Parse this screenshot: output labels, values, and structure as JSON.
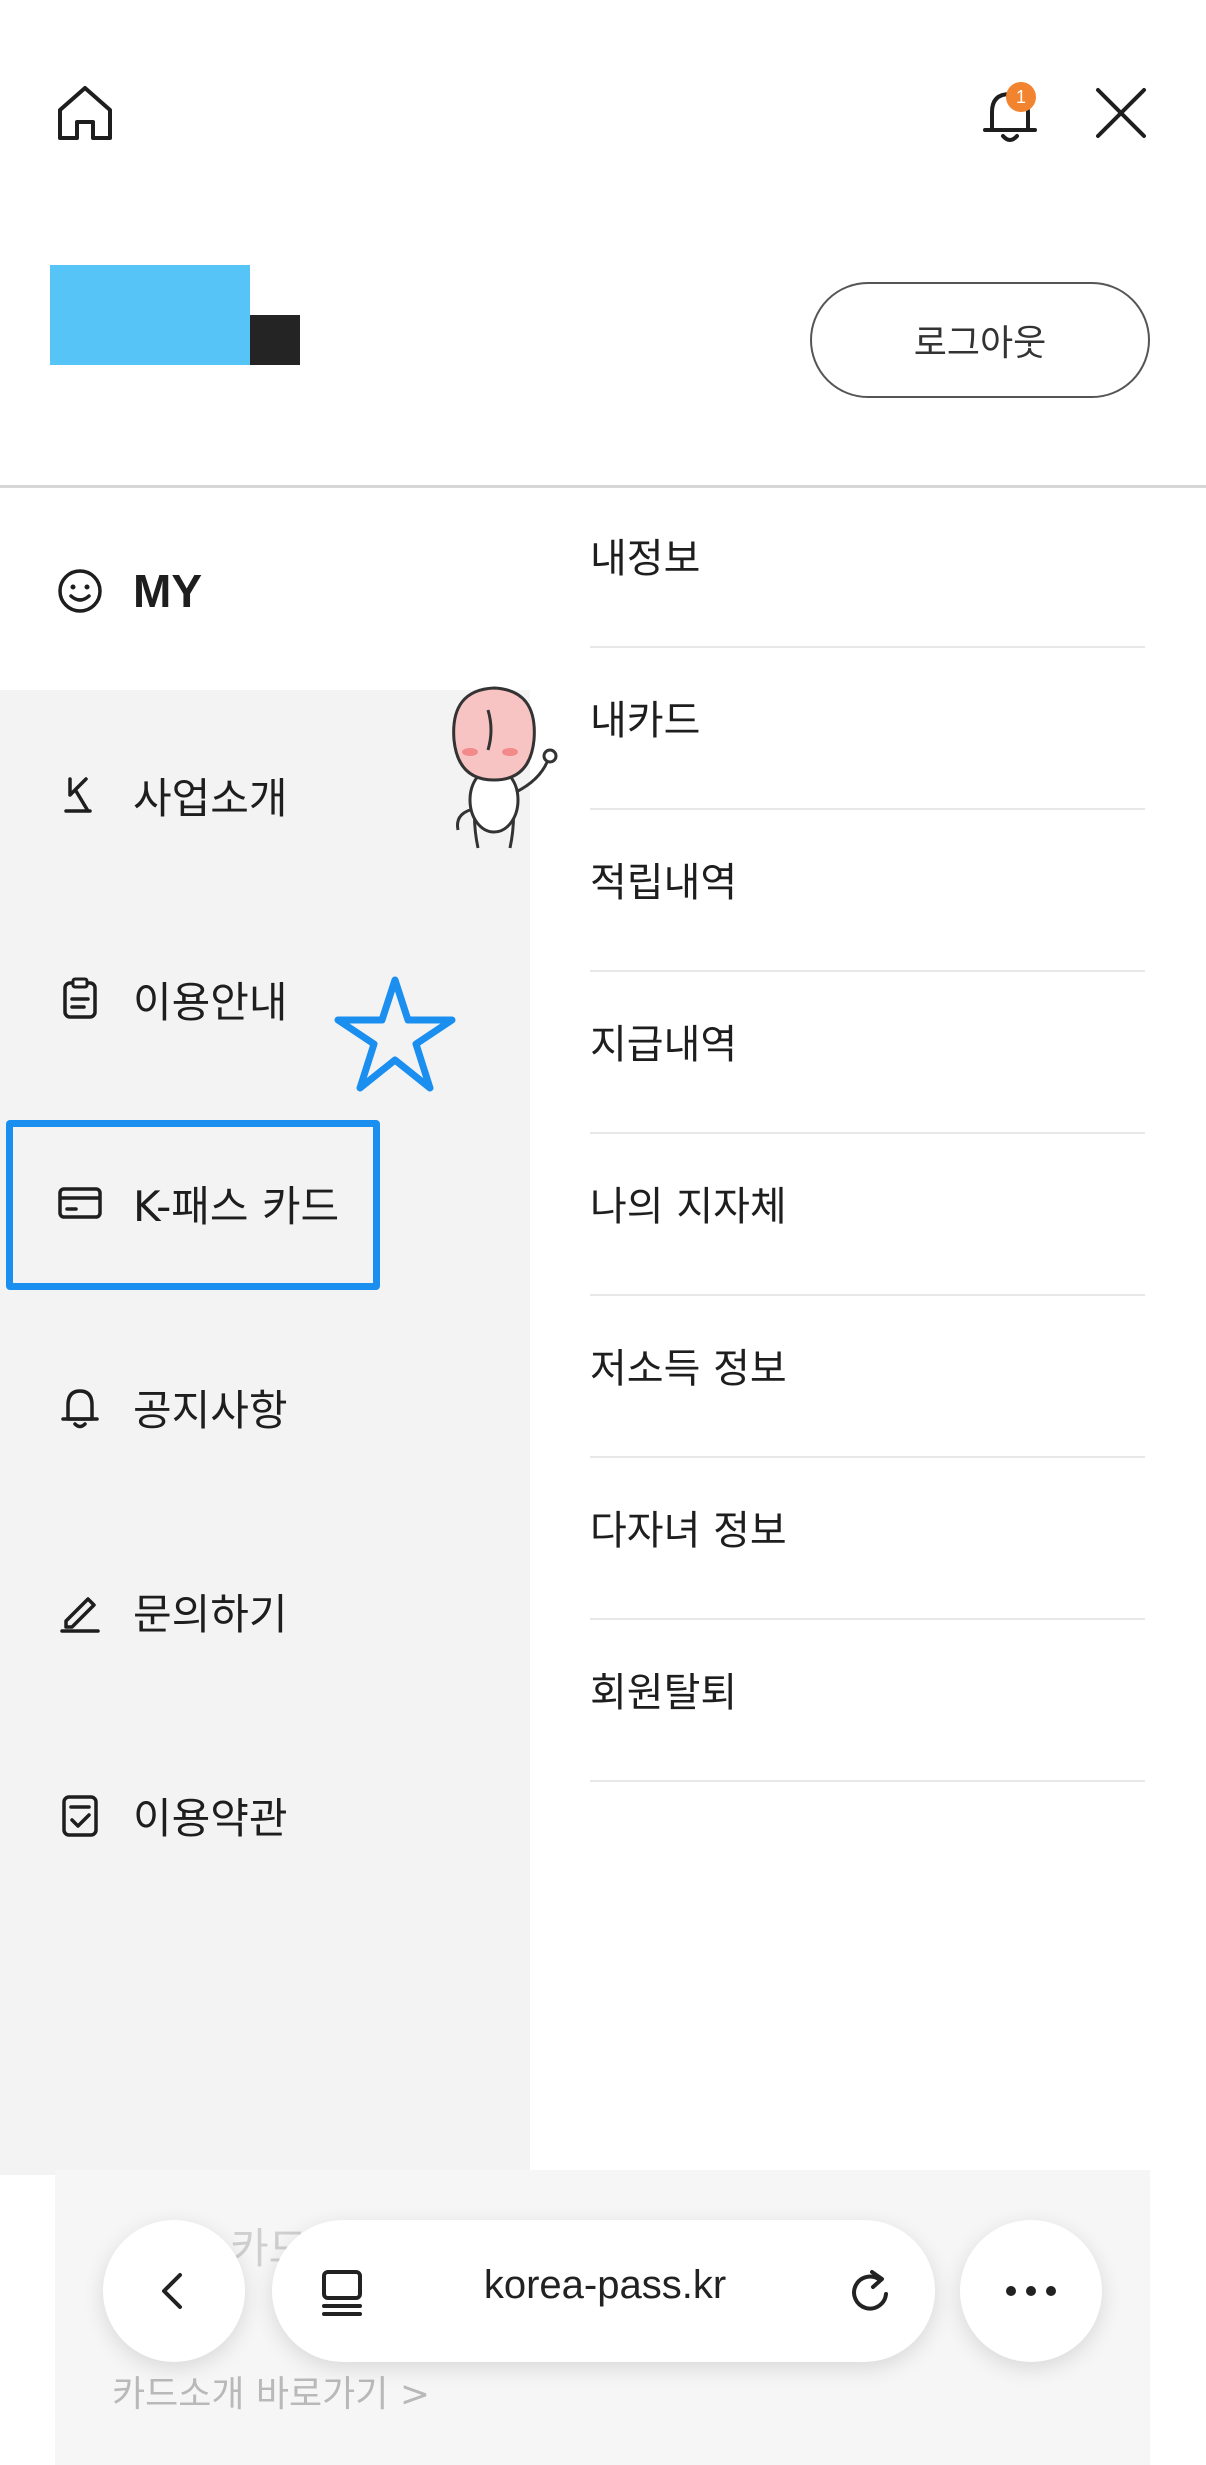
{
  "header": {
    "notification_count": "1",
    "logout_label": "로그아웃"
  },
  "colors": {
    "accent_badge": "#f28430",
    "annotation_blue": "#1a8ff0",
    "avatar_blue": "#57c4f8",
    "left_nav_bg": "#f3f3f3"
  },
  "left_nav": {
    "items": [
      {
        "label": "MY",
        "icon": "smile-icon"
      },
      {
        "label": "사업소개",
        "icon": "k-logo-icon"
      },
      {
        "label": "이용안내",
        "icon": "clipboard-icon"
      },
      {
        "label": "K-패스 카드",
        "icon": "card-icon"
      },
      {
        "label": "공지사항",
        "icon": "bell-icon"
      },
      {
        "label": "문의하기",
        "icon": "pencil-icon"
      },
      {
        "label": "이용약관",
        "icon": "document-check-icon"
      }
    ]
  },
  "sub_menu": {
    "items": [
      {
        "label": "내정보"
      },
      {
        "label": "내카드"
      },
      {
        "label": "적립내역"
      },
      {
        "label": "지급내역"
      },
      {
        "label": "나의 지자체"
      },
      {
        "label": "저소득 정보"
      },
      {
        "label": "다자녀 정보"
      },
      {
        "label": "회원탈퇴"
      }
    ]
  },
  "bottom": {
    "card_link": "카드소개 바로가기  >",
    "ghost_text": "카드 바로가기 안내"
  },
  "browser_bar": {
    "url": "korea-pass.kr"
  }
}
